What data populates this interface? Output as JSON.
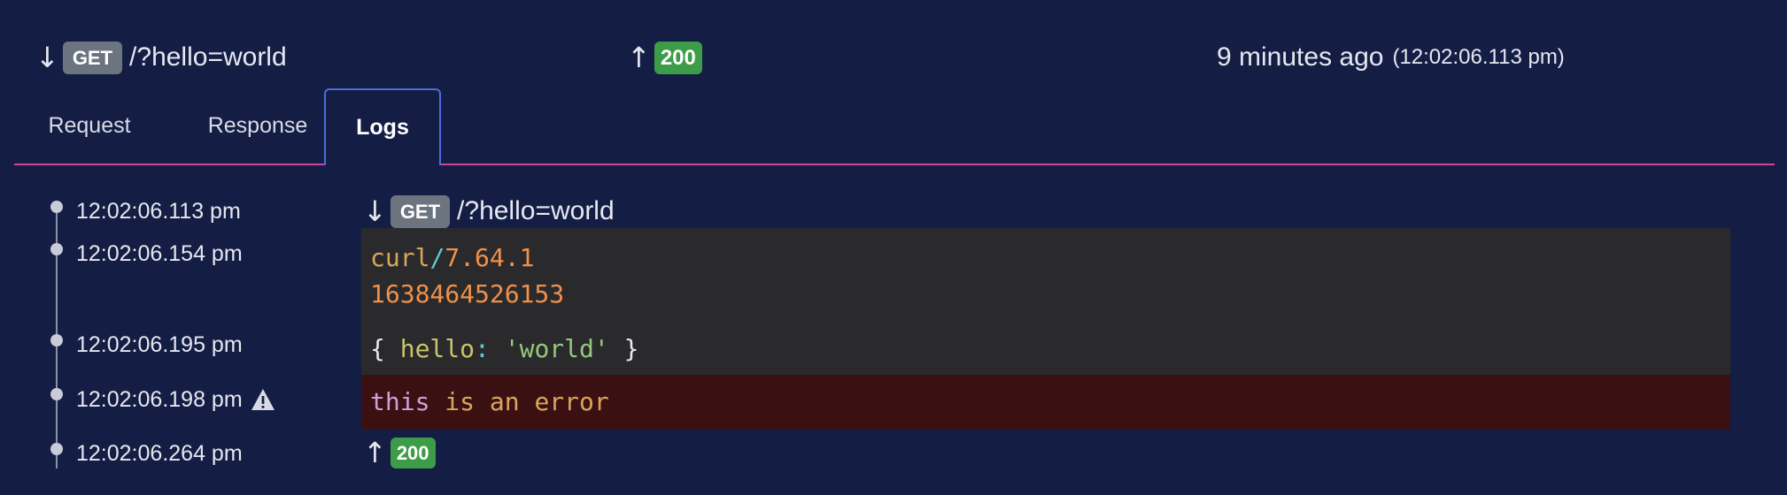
{
  "summary": {
    "request_arrow": "↓",
    "method": "GET",
    "path": "/?hello=world",
    "response_arrow": "↑",
    "status": "200",
    "relative_time": "9 minutes ago",
    "absolute_time": "(12:02:06.113 pm)"
  },
  "tabs": [
    {
      "label": "Request",
      "active": false
    },
    {
      "label": "Response",
      "active": false
    },
    {
      "label": "Logs",
      "active": true
    }
  ],
  "timeline": {
    "events": [
      {
        "time": "12:02:06.113 pm",
        "warning": false
      },
      {
        "time": "12:02:06.154 pm",
        "warning": false
      },
      {
        "time": "12:02:06.195 pm",
        "warning": false
      },
      {
        "time": "12:02:06.198 pm",
        "warning": true
      },
      {
        "time": "12:02:06.264 pm",
        "warning": false
      }
    ]
  },
  "logs": {
    "request": {
      "arrow": "↓",
      "method": "GET",
      "path": "/?hello=world"
    },
    "log1_ident": "curl",
    "log1_sep": "/",
    "log1_version": "7.64.1",
    "log2_number": "1638464526153",
    "log3_open": "{",
    "log3_key": "hello",
    "log3_colon": ":",
    "log3_value": "'world'",
    "log3_close": "}",
    "error_this": "this",
    "error_rest": "is an error",
    "response": {
      "arrow": "↑",
      "status": "200"
    }
  },
  "colors": {
    "background": "#141e45",
    "tab_underline": "#d6428e",
    "active_tab_border": "#4a6fd8",
    "get_badge": "#6c7480",
    "ok_badge": "#3d9c47",
    "log_bg": "#2a2a2c",
    "error_bg": "#3b1013"
  },
  "icons": {
    "request_arrow": "arrow-down-icon",
    "response_arrow": "arrow-up-icon",
    "warning": "warning-icon",
    "timeline_dot": "timeline-dot-icon"
  }
}
